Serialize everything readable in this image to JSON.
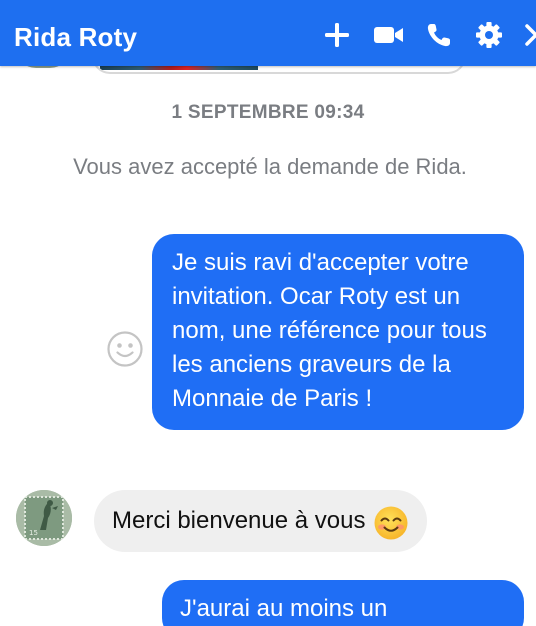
{
  "header": {
    "title": "Rida Roty",
    "background_color": "#1e6ff0",
    "icons": [
      "plus-icon",
      "video-camera-icon",
      "phone-icon",
      "gear-icon",
      "close-icon"
    ]
  },
  "thread": {
    "timestamp": "1 SEPTEMBRE 09:34",
    "system_message": "Vous avez accepté la demande de Rida.",
    "messages": [
      {
        "direction": "outgoing",
        "text": "Je suis ravi d'accepter votre invitation. Ocar Roty est un nom, une référence pour tous les anciens graveurs de la Monnaie de Paris !"
      },
      {
        "direction": "incoming",
        "text": "Merci bienvenue à vous",
        "emoji": "smiling-face-emoji"
      },
      {
        "direction": "outgoing",
        "text": "J'aurai au moins un"
      }
    ],
    "outgoing_bubble_color": "#1f6ef5",
    "incoming_bubble_color": "#efefef"
  }
}
